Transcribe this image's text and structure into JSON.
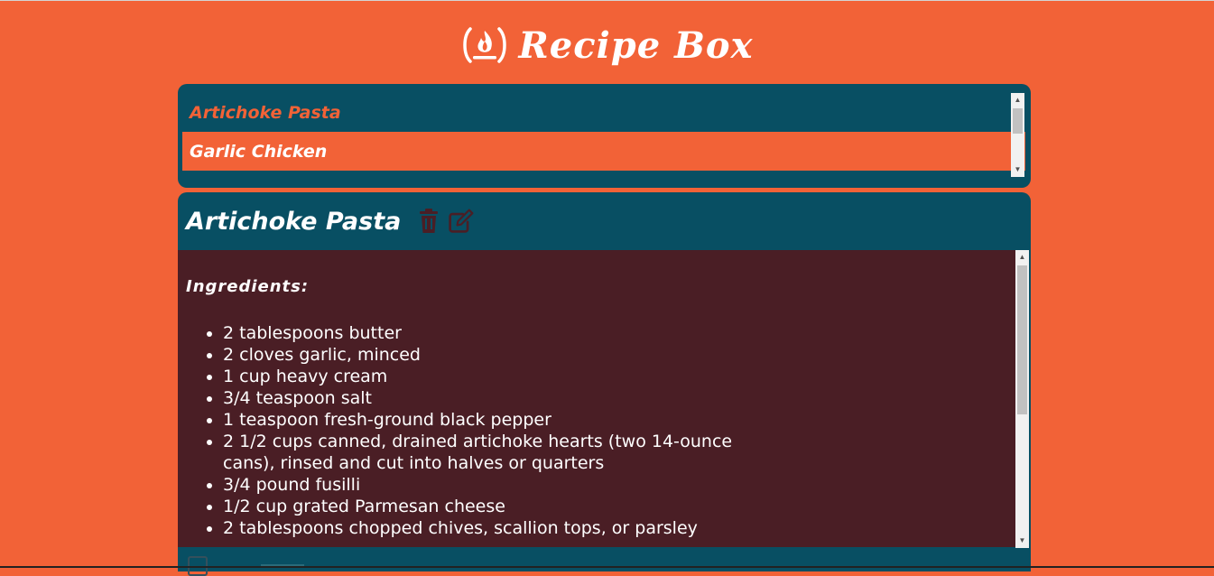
{
  "app": {
    "title": "Recipe Box",
    "logo_icon": "campfire-icon"
  },
  "colors": {
    "background": "#F26237",
    "panel": "#084F63",
    "content": "#4A1E25",
    "selected_item": "#F26237",
    "text_light": "#FFFFFF"
  },
  "recipe_list": {
    "items": [
      {
        "label": "Artichoke Pasta"
      },
      {
        "label": "Garlic Chicken"
      }
    ]
  },
  "detail": {
    "title": "Artichoke Pasta",
    "delete_icon": "trash-icon",
    "edit_icon": "edit-icon",
    "ingredients_heading": "Ingredients:",
    "ingredients": [
      "2 tablespoons butter",
      "2 cloves garlic, minced",
      "1 cup heavy cream",
      "3/4 teaspoon salt",
      "1 teaspoon fresh-ground black pepper",
      "2 1/2 cups canned, drained artichoke hearts (two 14-ounce cans), rinsed and cut into halves or quarters",
      "3/4 pound fusilli",
      "1/2 cup grated Parmesan cheese",
      "2 tablespoons chopped chives, scallion tops, or parsley"
    ],
    "footer_icon": "add-recipe-icon"
  }
}
